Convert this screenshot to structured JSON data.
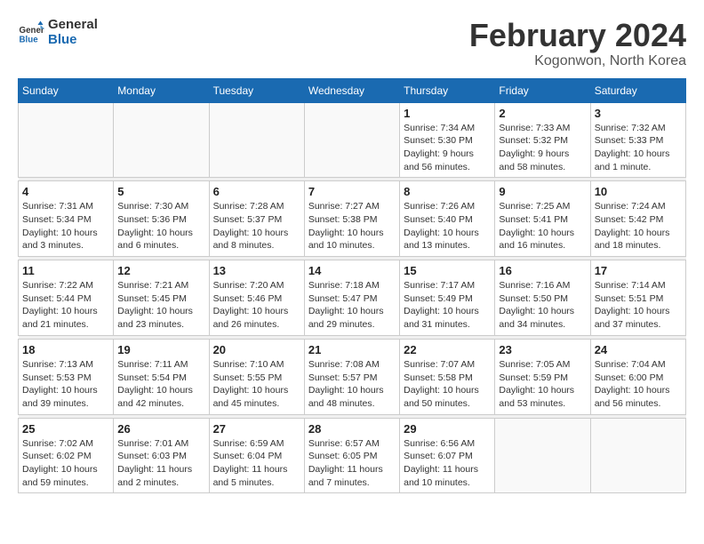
{
  "logo": {
    "line1": "General",
    "line2": "Blue"
  },
  "title": "February 2024",
  "location": "Kogonwon, North Korea",
  "weekdays": [
    "Sunday",
    "Monday",
    "Tuesday",
    "Wednesday",
    "Thursday",
    "Friday",
    "Saturday"
  ],
  "weeks": [
    [
      {
        "day": "",
        "info": ""
      },
      {
        "day": "",
        "info": ""
      },
      {
        "day": "",
        "info": ""
      },
      {
        "day": "",
        "info": ""
      },
      {
        "day": "1",
        "info": "Sunrise: 7:34 AM\nSunset: 5:30 PM\nDaylight: 9 hours\nand 56 minutes."
      },
      {
        "day": "2",
        "info": "Sunrise: 7:33 AM\nSunset: 5:32 PM\nDaylight: 9 hours\nand 58 minutes."
      },
      {
        "day": "3",
        "info": "Sunrise: 7:32 AM\nSunset: 5:33 PM\nDaylight: 10 hours\nand 1 minute."
      }
    ],
    [
      {
        "day": "4",
        "info": "Sunrise: 7:31 AM\nSunset: 5:34 PM\nDaylight: 10 hours\nand 3 minutes."
      },
      {
        "day": "5",
        "info": "Sunrise: 7:30 AM\nSunset: 5:36 PM\nDaylight: 10 hours\nand 6 minutes."
      },
      {
        "day": "6",
        "info": "Sunrise: 7:28 AM\nSunset: 5:37 PM\nDaylight: 10 hours\nand 8 minutes."
      },
      {
        "day": "7",
        "info": "Sunrise: 7:27 AM\nSunset: 5:38 PM\nDaylight: 10 hours\nand 10 minutes."
      },
      {
        "day": "8",
        "info": "Sunrise: 7:26 AM\nSunset: 5:40 PM\nDaylight: 10 hours\nand 13 minutes."
      },
      {
        "day": "9",
        "info": "Sunrise: 7:25 AM\nSunset: 5:41 PM\nDaylight: 10 hours\nand 16 minutes."
      },
      {
        "day": "10",
        "info": "Sunrise: 7:24 AM\nSunset: 5:42 PM\nDaylight: 10 hours\nand 18 minutes."
      }
    ],
    [
      {
        "day": "11",
        "info": "Sunrise: 7:22 AM\nSunset: 5:44 PM\nDaylight: 10 hours\nand 21 minutes."
      },
      {
        "day": "12",
        "info": "Sunrise: 7:21 AM\nSunset: 5:45 PM\nDaylight: 10 hours\nand 23 minutes."
      },
      {
        "day": "13",
        "info": "Sunrise: 7:20 AM\nSunset: 5:46 PM\nDaylight: 10 hours\nand 26 minutes."
      },
      {
        "day": "14",
        "info": "Sunrise: 7:18 AM\nSunset: 5:47 PM\nDaylight: 10 hours\nand 29 minutes."
      },
      {
        "day": "15",
        "info": "Sunrise: 7:17 AM\nSunset: 5:49 PM\nDaylight: 10 hours\nand 31 minutes."
      },
      {
        "day": "16",
        "info": "Sunrise: 7:16 AM\nSunset: 5:50 PM\nDaylight: 10 hours\nand 34 minutes."
      },
      {
        "day": "17",
        "info": "Sunrise: 7:14 AM\nSunset: 5:51 PM\nDaylight: 10 hours\nand 37 minutes."
      }
    ],
    [
      {
        "day": "18",
        "info": "Sunrise: 7:13 AM\nSunset: 5:53 PM\nDaylight: 10 hours\nand 39 minutes."
      },
      {
        "day": "19",
        "info": "Sunrise: 7:11 AM\nSunset: 5:54 PM\nDaylight: 10 hours\nand 42 minutes."
      },
      {
        "day": "20",
        "info": "Sunrise: 7:10 AM\nSunset: 5:55 PM\nDaylight: 10 hours\nand 45 minutes."
      },
      {
        "day": "21",
        "info": "Sunrise: 7:08 AM\nSunset: 5:57 PM\nDaylight: 10 hours\nand 48 minutes."
      },
      {
        "day": "22",
        "info": "Sunrise: 7:07 AM\nSunset: 5:58 PM\nDaylight: 10 hours\nand 50 minutes."
      },
      {
        "day": "23",
        "info": "Sunrise: 7:05 AM\nSunset: 5:59 PM\nDaylight: 10 hours\nand 53 minutes."
      },
      {
        "day": "24",
        "info": "Sunrise: 7:04 AM\nSunset: 6:00 PM\nDaylight: 10 hours\nand 56 minutes."
      }
    ],
    [
      {
        "day": "25",
        "info": "Sunrise: 7:02 AM\nSunset: 6:02 PM\nDaylight: 10 hours\nand 59 minutes."
      },
      {
        "day": "26",
        "info": "Sunrise: 7:01 AM\nSunset: 6:03 PM\nDaylight: 11 hours\nand 2 minutes."
      },
      {
        "day": "27",
        "info": "Sunrise: 6:59 AM\nSunset: 6:04 PM\nDaylight: 11 hours\nand 5 minutes."
      },
      {
        "day": "28",
        "info": "Sunrise: 6:57 AM\nSunset: 6:05 PM\nDaylight: 11 hours\nand 7 minutes."
      },
      {
        "day": "29",
        "info": "Sunrise: 6:56 AM\nSunset: 6:07 PM\nDaylight: 11 hours\nand 10 minutes."
      },
      {
        "day": "",
        "info": ""
      },
      {
        "day": "",
        "info": ""
      }
    ]
  ]
}
